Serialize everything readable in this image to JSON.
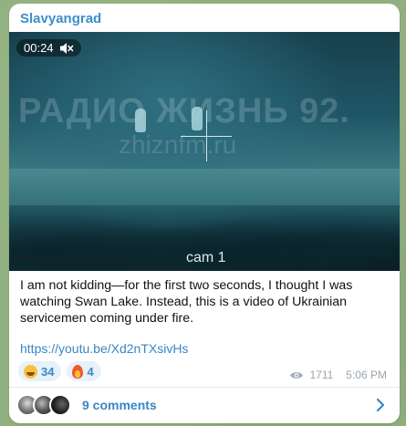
{
  "message": {
    "channel_name": "Slavyangrad",
    "video": {
      "duration": "00:24",
      "muted_icon": "speaker-muted-icon",
      "watermark_text": "РАДИО ЖИЗНЬ 92.",
      "watermark_url": "zhiznfm.ru",
      "camera_label": "cam 1"
    },
    "caption": "I am not kidding—for the first two seconds, I thought I was watching Swan Lake. Instead, this is a video of Ukrainian servicemen coming under fire.",
    "link": "https://youtu.be/Xd2nTXsivHs",
    "reactions": [
      {
        "icon": "laughing-emoji-icon",
        "count": "34"
      },
      {
        "icon": "fire-emoji-icon",
        "count": "4"
      }
    ],
    "views": "1711",
    "time": "5:06 PM"
  },
  "comments": {
    "label": "9 comments"
  },
  "colors": {
    "accent": "#3a86c4",
    "channel": "#3c8fc9",
    "background": "#92b07f"
  }
}
